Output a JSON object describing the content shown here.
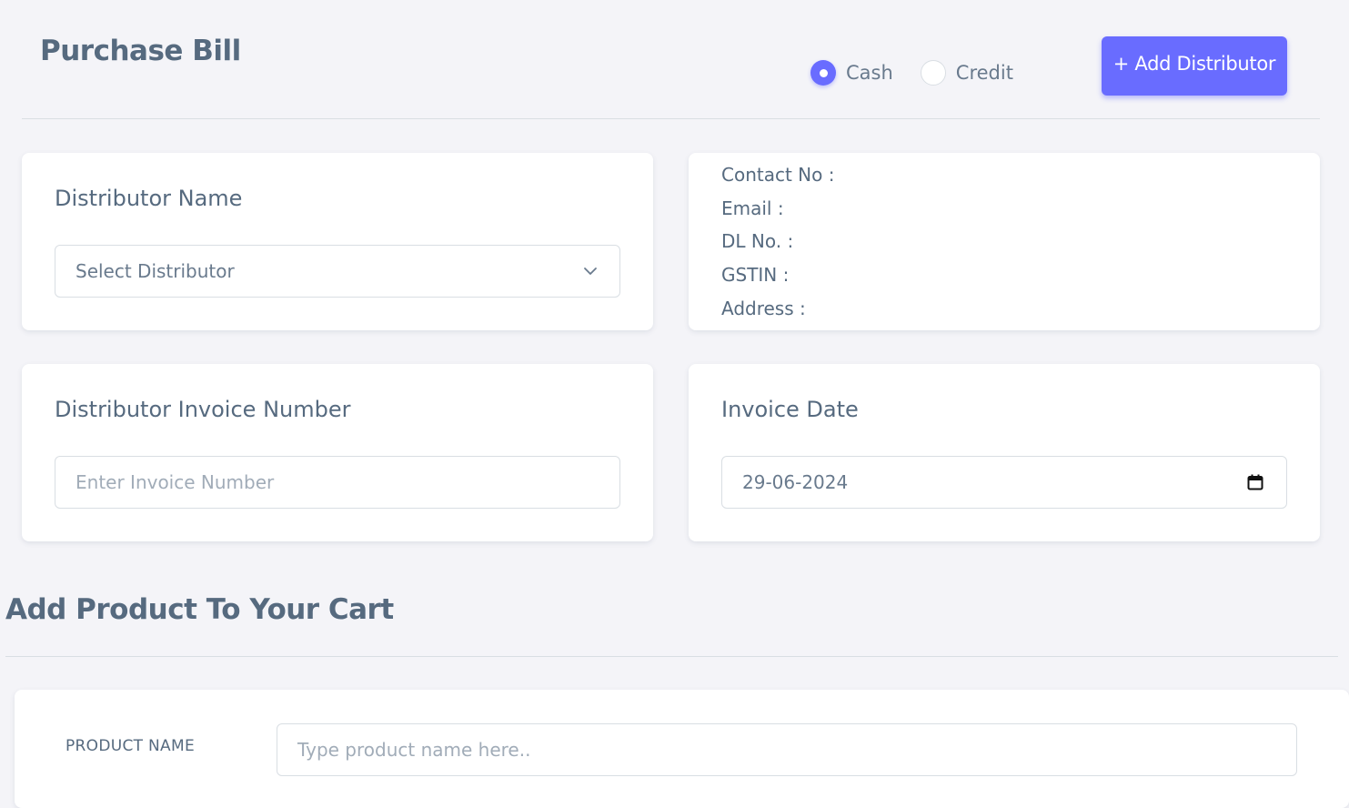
{
  "header": {
    "title": "Purchase Bill",
    "payment_options": [
      {
        "label": "Cash",
        "selected": true
      },
      {
        "label": "Credit",
        "selected": false
      }
    ],
    "add_button_label": "+ Add Distributor"
  },
  "distributor": {
    "label": "Distributor Name",
    "select_value": "Select Distributor"
  },
  "distributor_info": {
    "contact": "Contact No :",
    "email": "Email :",
    "dl": "DL No. :",
    "gstin": "GSTIN :",
    "address": "Address :"
  },
  "invoice_number": {
    "label": "Distributor Invoice Number",
    "placeholder": "Enter Invoice Number"
  },
  "invoice_date": {
    "label": "Invoice Date",
    "value": "29-06-2024"
  },
  "cart": {
    "title": "Add Product To Your Cart",
    "product_label": "PRODUCT NAME",
    "product_placeholder": "Type product name here.."
  },
  "colors": {
    "accent": "#696cff",
    "text": "#566a7f",
    "background": "#f4f4f8"
  }
}
